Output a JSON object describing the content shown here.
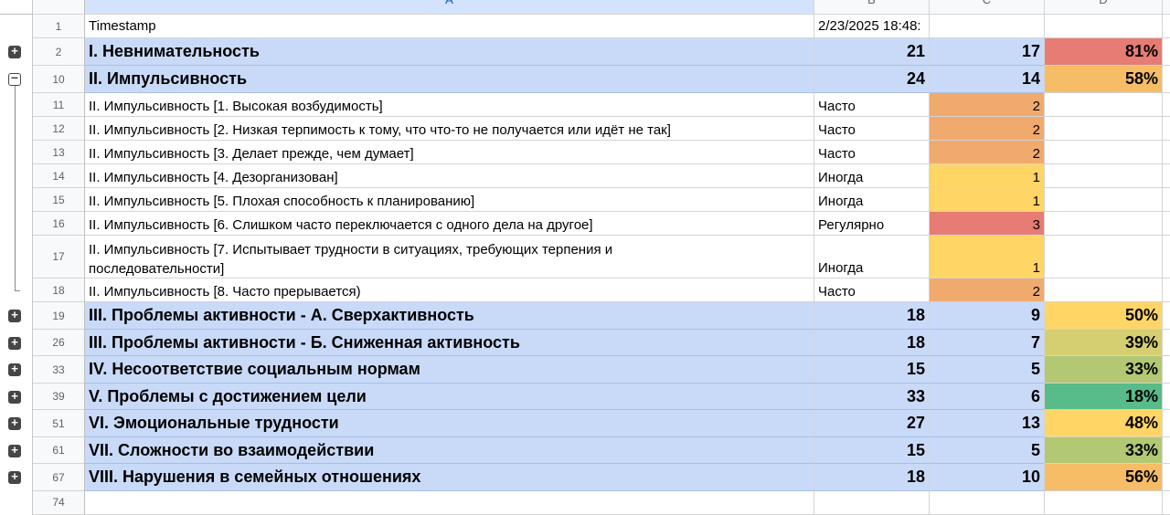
{
  "colors": {
    "group_row": "#c9daf8",
    "red": "#e67c73",
    "orange": "#f1aa6d",
    "amber": "#f6bd66",
    "yellow": "#ffd666",
    "yellow_green": "#d5cf72",
    "light_green": "#b2c873",
    "green": "#57bb8a",
    "selected_header": "#d3e3fd"
  },
  "headers": {
    "A": "A",
    "B": "B",
    "C": "C",
    "D": "D"
  },
  "rows": [
    {
      "num": "1",
      "a": "Timestamp",
      "b": "2/23/2025 18:48:",
      "c": "",
      "d": ""
    },
    {
      "num": "2",
      "a": "I. Невнимательность",
      "b": "21",
      "c": "17",
      "d": "81%"
    },
    {
      "num": "10",
      "a": "II. Импульсивность",
      "b": "24",
      "c": "14",
      "d": "58%"
    },
    {
      "num": "11",
      "a": "II. Импульсивность [1. Высокая возбудимость]",
      "b": "Часто",
      "c": "2",
      "d": ""
    },
    {
      "num": "12",
      "a": "II. Импульсивность [2. Низкая терпимость к тому, что что-то не получается или идёт не так]",
      "b": "Часто",
      "c": "2",
      "d": ""
    },
    {
      "num": "13",
      "a": "II. Импульсивность [3. Делает прежде, чем думает]",
      "b": "Часто",
      "c": "2",
      "d": ""
    },
    {
      "num": "14",
      "a": "II. Импульсивность [4. Дезорганизован]",
      "b": "Иногда",
      "c": "1",
      "d": ""
    },
    {
      "num": "15",
      "a": "II. Импульсивность [5. Плохая способность к планированию]",
      "b": "Иногда",
      "c": "1",
      "d": ""
    },
    {
      "num": "16",
      "a": "II. Импульсивность [6. Слишком часто переключается с одного дела на другое]",
      "b": "Регулярно",
      "c": "3",
      "d": ""
    },
    {
      "num": "17",
      "a_line1": "II. Импульсивность [7. Испытывает трудности в ситуациях, требующих терпения и",
      "a_line2": "последовательности]",
      "b": "Иногда",
      "c": "1",
      "d": ""
    },
    {
      "num": "18",
      "a": "II. Импульсивность [8. Часто прерывается)",
      "b": "Часто",
      "c": "2",
      "d": ""
    },
    {
      "num": "19",
      "a": "III. Проблемы активности - А. Сверхактивность",
      "b": "18",
      "c": "9",
      "d": "50%"
    },
    {
      "num": "26",
      "a": "III. Проблемы активности - Б. Сниженная активность",
      "b": "18",
      "c": "7",
      "d": "39%"
    },
    {
      "num": "33",
      "a": "IV. Несоответствие социальным нормам",
      "b": "15",
      "c": "5",
      "d": "33%"
    },
    {
      "num": "39",
      "a": "V. Проблемы с достижением цели",
      "b": "33",
      "c": "6",
      "d": "18%"
    },
    {
      "num": "51",
      "a": "VI. Эмоциональные трудности",
      "b": "27",
      "c": "13",
      "d": "48%"
    },
    {
      "num": "61",
      "a": "VII. Сложности во взаимодействии",
      "b": "15",
      "c": "5",
      "d": "33%"
    },
    {
      "num": "67",
      "a": "VIII. Нарушения в семейных отношениях",
      "b": "18",
      "c": "10",
      "d": "56%"
    },
    {
      "num": "74",
      "a": "",
      "b": "",
      "c": "",
      "d": ""
    }
  ],
  "group_toggle": {
    "expand_symbol": "+",
    "collapse_symbol": "−"
  }
}
